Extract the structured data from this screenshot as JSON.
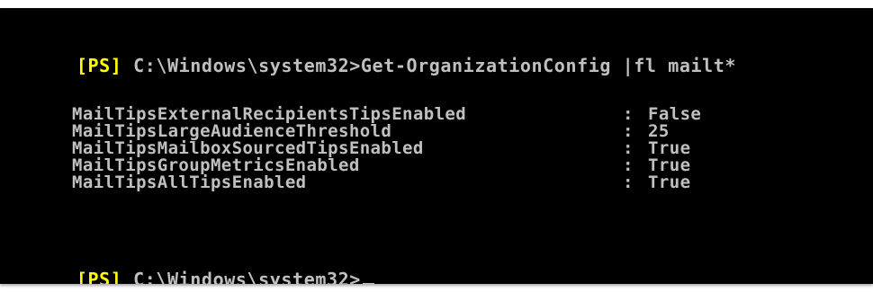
{
  "console": {
    "prompt_tag": "[PS]",
    "prompt_path": " C:\\Windows\\system32>",
    "command": "Get-OrganizationConfig |fl mailt*",
    "separator": ":",
    "output": [
      {
        "key": "MailTipsExternalRecipientsTipsEnabled",
        "value": "False"
      },
      {
        "key": "MailTipsLargeAudienceThreshold",
        "value": "25"
      },
      {
        "key": "MailTipsMailboxSourcedTipsEnabled",
        "value": "True"
      },
      {
        "key": "MailTipsGroupMetricsEnabled",
        "value": "True"
      },
      {
        "key": "MailTipsAllTipsEnabled",
        "value": "True"
      }
    ],
    "colors": {
      "background": "#000000",
      "text": "#c0c0c0",
      "prompt_tag": "#ffff00"
    }
  }
}
